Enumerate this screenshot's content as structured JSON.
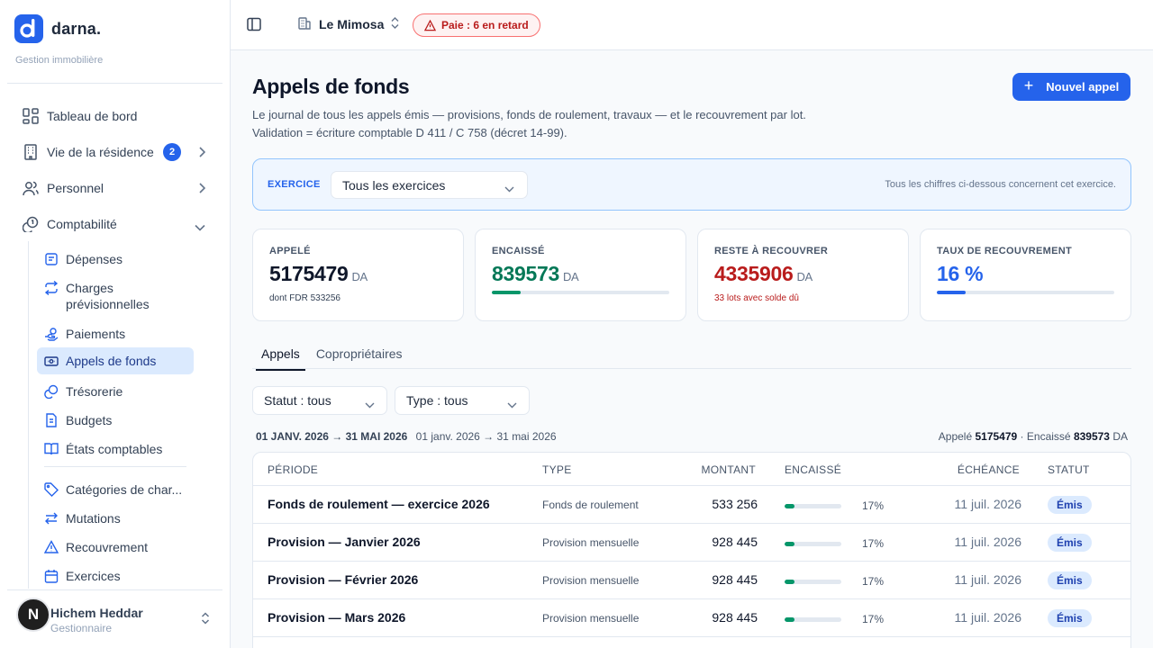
{
  "brand": {
    "name": "darna.",
    "subtitle": "Gestion immobilière"
  },
  "sidebar": {
    "items": [
      {
        "label": "Tableau de bord",
        "icon": "dashboard-icon"
      },
      {
        "label": "Vie de la résidence",
        "icon": "building-icon",
        "badge": "2"
      },
      {
        "label": "Personnel",
        "icon": "users-icon"
      },
      {
        "label": "Comptabilité",
        "icon": "coins-icon"
      }
    ],
    "sub_items": [
      {
        "label": "Dépenses",
        "icon": "receipt-icon"
      },
      {
        "label": "Charges prévisionnelles",
        "icon": "repeat-icon"
      },
      {
        "label": "Paiements",
        "icon": "hand-coins-icon"
      },
      {
        "label": "Appels de fonds",
        "icon": "banknote-icon",
        "active": true
      },
      {
        "label": "Trésorerie",
        "icon": "coins-icon"
      },
      {
        "label": "Budgets",
        "icon": "file-icon"
      },
      {
        "label": "États comptables",
        "icon": "book-icon"
      },
      {
        "label": "Catégories de char...",
        "icon": "tag-icon"
      },
      {
        "label": "Mutations",
        "icon": "swap-icon"
      },
      {
        "label": "Recouvrement",
        "icon": "warning-icon"
      },
      {
        "label": "Exercices",
        "icon": "calendar-icon"
      }
    ],
    "user": {
      "initial": "N",
      "name": "Hichem Heddar",
      "role": "Gestionnaire"
    }
  },
  "topbar": {
    "residence": "Le Mimosa",
    "alert": "Paie : 6 en retard"
  },
  "page": {
    "title": "Appels de fonds",
    "desc_line1": "Le journal de tous les appels émis — provisions, fonds de roulement, travaux — et le recouvrement par lot.",
    "desc_line2": "Validation = écriture comptable D 411 / C 758 (décret 14-99).",
    "new_button": "Nouvel appel"
  },
  "exercise": {
    "label": "EXERCICE",
    "value": "Tous les exercices",
    "note": "Tous les chiffres ci-dessous concernent cet exercice."
  },
  "kpis": {
    "called": {
      "label": "APPELÉ",
      "value": "5175479",
      "unit": "DA",
      "sub": "dont FDR 533256"
    },
    "collected": {
      "label": "ENCAISSÉ",
      "value": "839573",
      "unit": "DA",
      "progress": 0.16
    },
    "remaining": {
      "label": "RESTE À RECOUVRER",
      "value": "4335906",
      "unit": "DA",
      "sub": "33 lots avec solde dû"
    },
    "rate": {
      "label": "TAUX DE RECOUVREMENT",
      "value": "16 %",
      "progress": 0.16
    }
  },
  "tabs": [
    "Appels",
    "Copropriétaires"
  ],
  "filters": {
    "status": "Statut : tous",
    "type": "Type : tous"
  },
  "range": {
    "bold": "01 JANV. 2026 → 31 MAI 2026",
    "plain": "01 janv. 2026 → 31 mai 2026"
  },
  "totals": {
    "called_label": "Appelé",
    "called": "5175479",
    "sep": "·",
    "collected_label": "Encaissé",
    "collected": "839573",
    "unit": "DA"
  },
  "table": {
    "headers": {
      "period": "PÉRIODE",
      "type": "TYPE",
      "amount": "MONTANT",
      "collected": "ENCAISSÉ",
      "due": "ÉCHÉANCE",
      "status": "STATUT"
    },
    "rows": [
      {
        "period": "Fonds de roulement — exercice 2026",
        "type": "Fonds de roulement",
        "amount": "533 256",
        "pct": "17%",
        "progress": 0.17,
        "due": "11 juil. 2026",
        "status": "Émis"
      },
      {
        "period": "Provision — Janvier 2026",
        "type": "Provision mensuelle",
        "amount": "928 445",
        "pct": "17%",
        "progress": 0.17,
        "due": "11 juil. 2026",
        "status": "Émis"
      },
      {
        "period": "Provision — Février 2026",
        "type": "Provision mensuelle",
        "amount": "928 445",
        "pct": "17%",
        "progress": 0.17,
        "due": "11 juil. 2026",
        "status": "Émis"
      },
      {
        "period": "Provision — Mars 2026",
        "type": "Provision mensuelle",
        "amount": "928 445",
        "pct": "17%",
        "progress": 0.17,
        "due": "11 juil. 2026",
        "status": "Émis"
      }
    ]
  },
  "colors": {
    "accent": "#2563eb",
    "success": "#047857",
    "danger": "#b91c1c"
  }
}
